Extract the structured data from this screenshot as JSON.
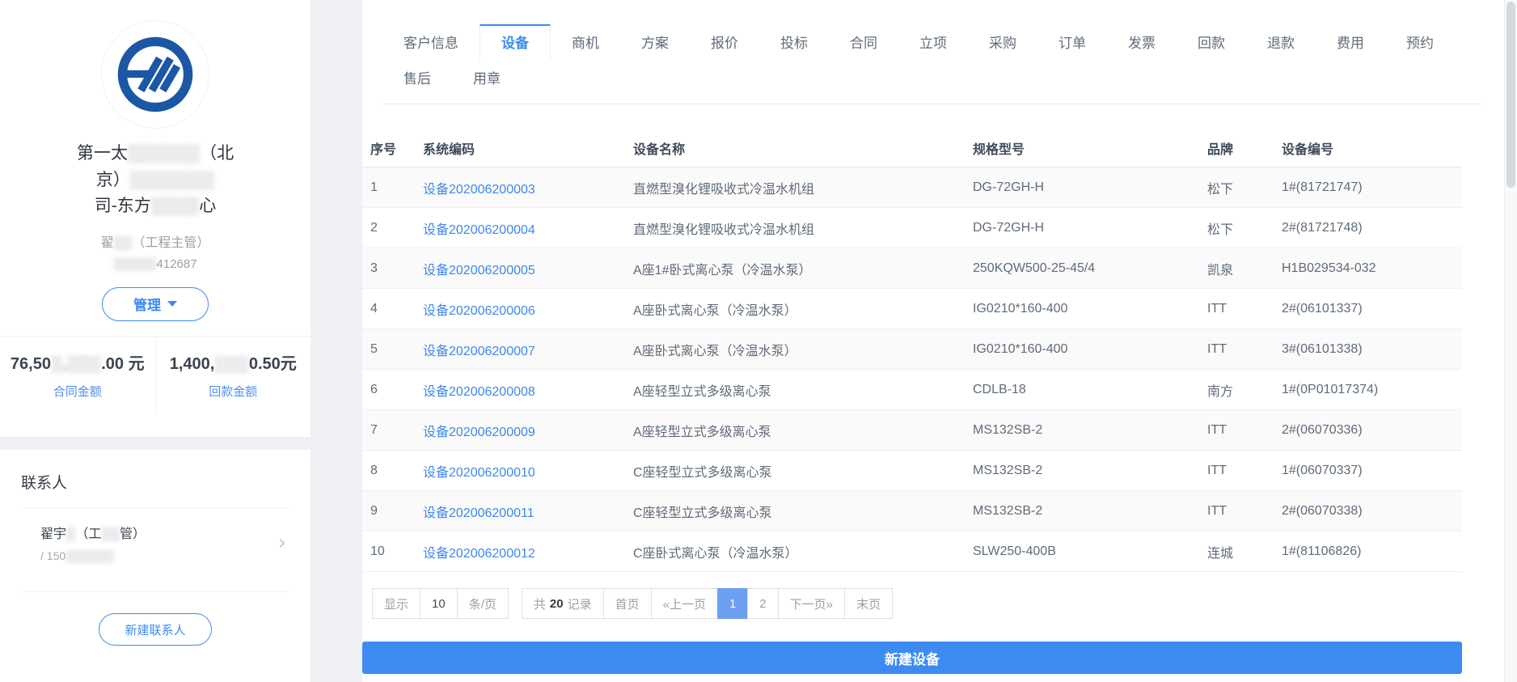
{
  "colors": {
    "accent": "#3d8bf2",
    "link": "#3d87ee",
    "pagination_active": "#6d9ff0",
    "logo_blue": "#1b57a5"
  },
  "sidebar": {
    "logo_icon": "company-logo",
    "company_name_lines": [
      [
        {
          "t": "第一太"
        },
        {
          "t": "▒▒▒▒▒▒",
          "b": true
        },
        {
          "t": "（北"
        }
      ],
      [
        {
          "t": "京）"
        },
        {
          "t": "▒▒▒▒▒▒▒",
          "b": true
        }
      ],
      [
        {
          "t": "司-东方"
        },
        {
          "t": "▒▒▒▒",
          "b": true
        },
        {
          "t": "心"
        }
      ]
    ],
    "contact_line": [
      {
        "t": "翟"
      },
      {
        "t": "▒▒",
        "b": true
      },
      {
        "t": "（工程主管）"
      }
    ],
    "phone_line": [
      {
        "t": "▒▒▒▒▒",
        "b": true
      },
      {
        "t": "412687"
      }
    ],
    "manage_label": "管理",
    "metrics": [
      {
        "value_segments": [
          {
            "t": "76,50"
          },
          {
            "t": "▒,▒▒▒",
            "b": true
          },
          {
            "t": ".00 元"
          }
        ],
        "label": "合同金额"
      },
      {
        "value_segments": [
          {
            "t": "1,400,"
          },
          {
            "t": "▒▒▒",
            "b": true
          },
          {
            "t": "0.50元"
          }
        ],
        "label": "回款金额"
      }
    ]
  },
  "contacts": {
    "title": "联系人",
    "items": [
      {
        "name_segments": [
          {
            "t": "翟宇"
          },
          {
            "t": "▒",
            "b": true
          },
          {
            "t": "（工"
          },
          {
            "t": "▒▒",
            "b": true
          },
          {
            "t": "管）"
          }
        ],
        "phone_segments": [
          {
            "t": "/ 150"
          },
          {
            "t": "▒▒▒▒▒▒",
            "b": true
          }
        ]
      }
    ],
    "new_button": "新建联系人"
  },
  "tabs": {
    "active": "设备",
    "items": [
      {
        "label": "客户信息"
      },
      {
        "label": "设备"
      },
      {
        "label": "商机"
      },
      {
        "label": "方案"
      },
      {
        "label": "报价"
      },
      {
        "label": "投标"
      },
      {
        "label": "合同"
      },
      {
        "label": "立项"
      },
      {
        "label": "采购"
      },
      {
        "label": "订单"
      },
      {
        "label": "发票"
      },
      {
        "label": "回款"
      },
      {
        "label": "退款"
      },
      {
        "label": "费用"
      },
      {
        "label": "预约"
      },
      {
        "label": "售后"
      },
      {
        "label": "用章"
      }
    ]
  },
  "table": {
    "columns": [
      "序号",
      "系统编码",
      "设备名称",
      "规格型号",
      "品牌",
      "设备编号"
    ],
    "rows": [
      [
        "1",
        "设备202006200003",
        "直燃型溴化锂吸收式冷温水机组",
        "DG-72GH-H",
        "松下",
        "1#(81721747)"
      ],
      [
        "2",
        "设备202006200004",
        "直燃型溴化锂吸收式冷温水机组",
        "DG-72GH-H",
        "松下",
        "2#(81721748)"
      ],
      [
        "3",
        "设备202006200005",
        "A座1#卧式离心泵（冷温水泵）",
        "250KQW500-25-45/4",
        "凯泉",
        "H1B029534-032"
      ],
      [
        "4",
        "设备202006200006",
        "A座卧式离心泵（冷温水泵）",
        "IG0210*160-400",
        "ITT",
        "2#(06101337)"
      ],
      [
        "5",
        "设备202006200007",
        "A座卧式离心泵（冷温水泵）",
        "IG0210*160-400",
        "ITT",
        "3#(06101338)"
      ],
      [
        "6",
        "设备202006200008",
        "A座轻型立式多级离心泵",
        "CDLB-18",
        "南方",
        "1#(0P01017374)"
      ],
      [
        "7",
        "设备202006200009",
        "A座轻型立式多级离心泵",
        "MS132SB-2",
        "ITT",
        "2#(06070336)"
      ],
      [
        "8",
        "设备202006200010",
        "C座轻型立式多级离心泵",
        "MS132SB-2",
        "ITT",
        "1#(06070337)"
      ],
      [
        "9",
        "设备202006200011",
        "C座轻型立式多级离心泵",
        "MS132SB-2",
        "ITT",
        "2#(06070338)"
      ],
      [
        "10",
        "设备202006200012",
        "C座卧式离心泵（冷温水泵）",
        "SLW250-400B",
        "连城",
        "1#(81106826)"
      ]
    ]
  },
  "pagination": {
    "show_label": "显示",
    "page_size": "10",
    "per_page_label": "条/页",
    "total_prefix": "共",
    "total": "20",
    "total_suffix": "记录",
    "active_page": "1",
    "buttons": [
      "首页",
      "«上一页",
      "1",
      "2",
      "下一页»",
      "末页"
    ]
  },
  "actions": {
    "new_device": "新建设备"
  }
}
